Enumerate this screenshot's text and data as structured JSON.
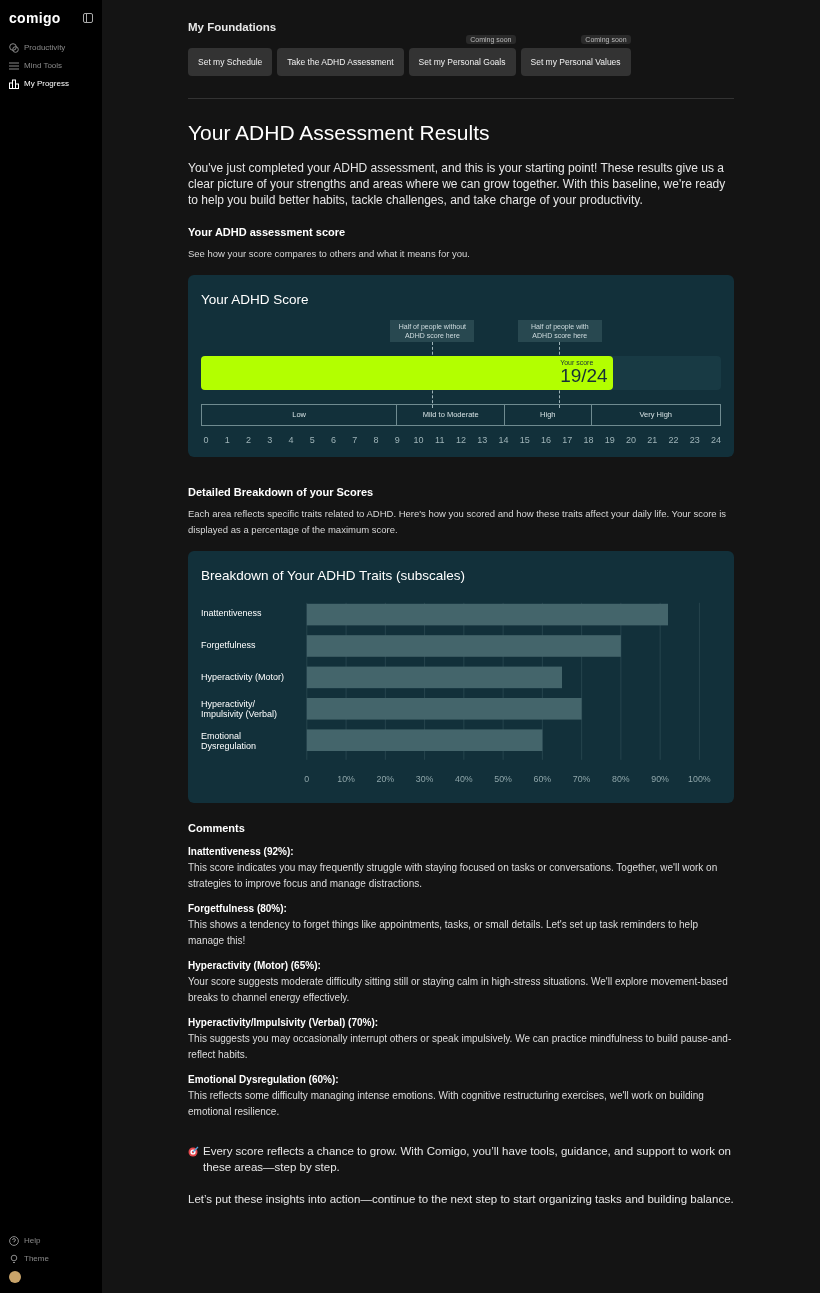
{
  "sidebar": {
    "logo": "comigo",
    "items": [
      {
        "label": "Productivity",
        "selected": false
      },
      {
        "label": "Mind Tools",
        "selected": false
      },
      {
        "label": "My Progress",
        "selected": true
      }
    ],
    "footer": [
      {
        "label": "Help"
      },
      {
        "label": "Theme"
      }
    ]
  },
  "foundations": {
    "title": "My Foundations",
    "buttons": [
      {
        "label": "Set my Schedule"
      },
      {
        "label": "Take the ADHD Assessment"
      },
      {
        "label": "Set my Personal Goals",
        "badge": "Coming soon"
      },
      {
        "label": "Set my Personal Values",
        "badge": "Coming soon"
      }
    ]
  },
  "title": "Your ADHD Assessment Results",
  "intro": "You've just completed your ADHD assessment, and this is your starting point! These results give us a clear picture of your strengths and areas where we can grow together. With this baseline, we're ready to help you build better habits, tackle challenges, and take charge of your productivity.",
  "score_section": {
    "heading": "Your ADHD assessment score",
    "text": "See how your score compares to others and what it means for you."
  },
  "score_card": {
    "title": "Your ADHD Score",
    "markers": [
      {
        "label": "Half of people without ADHD score here",
        "level": 0.445
      },
      {
        "label": "Half of people with ADHD score here",
        "level": 0.69
      }
    ],
    "score": {
      "caption": "Your score",
      "value": "19/24",
      "level": 0.7917
    },
    "bands": [
      {
        "label": "Low",
        "ticks": [
          "0",
          "1",
          "2",
          "3",
          "4",
          "5",
          "6",
          "7",
          "8"
        ]
      },
      {
        "label": "Mild to Moderate",
        "ticks": [
          "9",
          "10",
          "11",
          "12",
          "13"
        ]
      },
      {
        "label": "High",
        "ticks": [
          "14",
          "15",
          "16",
          "17"
        ]
      },
      {
        "label": "Very High",
        "ticks": [
          "18",
          "19",
          "20",
          "21",
          "22",
          "23",
          "24"
        ]
      }
    ]
  },
  "breakdown_section": {
    "heading": "Detailed Breakdown of your Scores",
    "text": "Each area reflects specific traits related to ADHD. Here's how you scored and how these traits affect your daily life. Your score is displayed as a percentage of the maximum score."
  },
  "breakdown_card": {
    "title": "Breakdown of Your ADHD Traits (subscales)",
    "chart_data": {
      "type": "bar",
      "orientation": "horizontal",
      "categories": [
        "Inattentiveness",
        "Forgetfulness",
        "Hyperactivity (Motor)",
        "Hyperactivity/ Impulsivity (Verbal)",
        "Emotional Dysregulation"
      ],
      "values": [
        92,
        80,
        65,
        70,
        60
      ],
      "xlim": [
        0,
        100
      ],
      "grid": true,
      "xticks": [
        {
          "value": 0,
          "label": "0"
        },
        {
          "value": 10,
          "label": "10%"
        },
        {
          "value": 20,
          "label": "20%"
        },
        {
          "value": 30,
          "label": "30%"
        },
        {
          "value": 40,
          "label": "40%"
        },
        {
          "value": 50,
          "label": "50%"
        },
        {
          "value": 60,
          "label": "60%"
        },
        {
          "value": 70,
          "label": "70%"
        },
        {
          "value": 80,
          "label": "80%"
        },
        {
          "value": 90,
          "label": "90%"
        },
        {
          "value": 100,
          "label": "100%"
        }
      ]
    }
  },
  "comments": {
    "title": "Comments",
    "items": [
      {
        "heading": "Inattentiveness (92%):",
        "text": "This score indicates you may frequently struggle with staying focused on tasks or conversations. Together, we'll work on strategies to improve focus and manage distractions."
      },
      {
        "heading": "Forgetfulness (80%):",
        "text": "This shows a tendency to forget things like appointments, tasks, or small details. Let's set up task reminders to help manage this!"
      },
      {
        "heading": "Hyperactivity (Motor) (65%):",
        "text": "Your score suggests moderate difficulty sitting still or staying calm in high-stress situations. We'll explore movement-based breaks to channel energy effectively."
      },
      {
        "heading": "Hyperactivity/Impulsivity (Verbal) (70%):",
        "text": "This suggests you may occasionally interrupt others or speak impulsively. We can practice mindfulness to build pause-and-reflect habits."
      },
      {
        "heading": "Emotional Dysregulation (60%):",
        "text": "This reflects some difficulty managing intense emotions. With cognitive restructuring exercises, we'll work on building emotional resilience."
      }
    ]
  },
  "closing": [
    "Every score reflects a chance to grow. With Comigo, you’ll have tools, guidance, and support to work on these areas—step by step.",
    "Let’s put these insights into action—continue to the next step to start organizing tasks and building balance."
  ]
}
